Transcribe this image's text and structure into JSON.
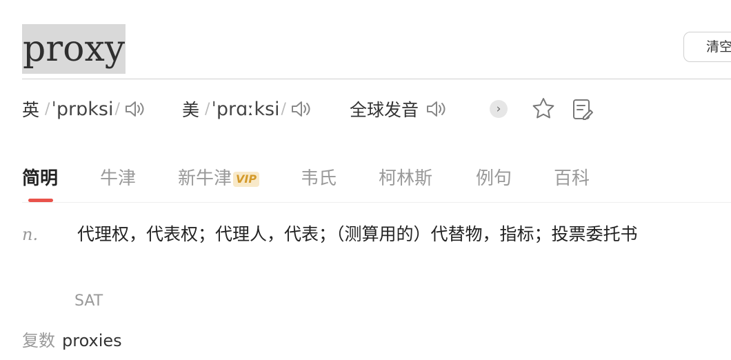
{
  "search": {
    "word": "proxy",
    "clear_label": "清空"
  },
  "pronunciation": {
    "uk": {
      "label": "英",
      "ipa": "ˈprɒksi"
    },
    "us": {
      "label": "美",
      "ipa": "ˈprɑːksi"
    },
    "global_label": "全球发音",
    "slash": "/"
  },
  "tabs": [
    {
      "label": "简明",
      "active": true
    },
    {
      "label": "牛津"
    },
    {
      "label": "新牛津",
      "badge": "VIP"
    },
    {
      "label": "韦氏"
    },
    {
      "label": "柯林斯"
    },
    {
      "label": "例句"
    },
    {
      "label": "百科"
    }
  ],
  "definition": {
    "pos": "n.",
    "text": "代理权，代表权；代理人，代表；（测算用的）代替物，指标；投票委托书",
    "tag": "SAT"
  },
  "forms": {
    "label": "复数",
    "value": "proxies"
  },
  "colors": {
    "accent": "#e9524a",
    "vip_bg": "#f8e9c9",
    "vip_text": "#d49a2a"
  }
}
